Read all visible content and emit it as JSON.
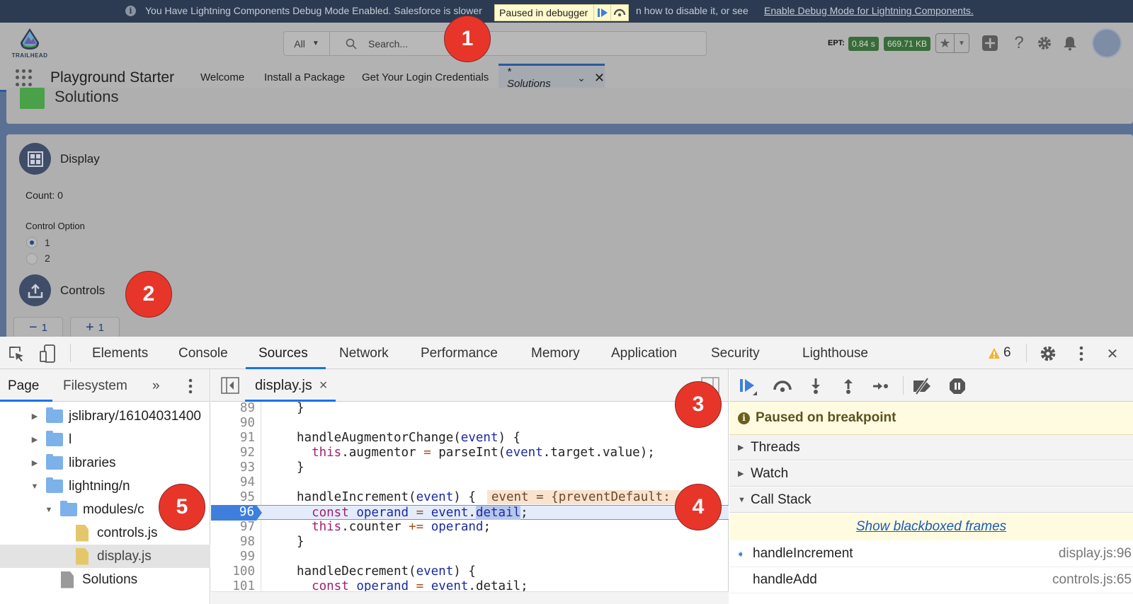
{
  "banner": {
    "message": "You Have Lightning Components Debug Mode Enabled. Salesforce is slower",
    "message_tail": "n how to disable it, or see",
    "link": "Enable Debug Mode for Lightning Components.",
    "paused_label": "Paused in debugger",
    "icons": [
      "resume-icon",
      "step-over-icon"
    ]
  },
  "header": {
    "logo_text": "TRAILHEAD",
    "search_scope": "All",
    "search_placeholder": "Search...",
    "ept_label": "EPT:",
    "ept_time": "0.84 s",
    "ept_size": "669.71 KB",
    "icons": [
      "favorite-star-icon",
      "add-icon",
      "help-icon",
      "setup-gear-icon",
      "notifications-bell-icon",
      "avatar"
    ]
  },
  "nav": {
    "app_name": "Playground Starter",
    "items": [
      "Welcome",
      "Install a Package",
      "Get Your Login Credentials"
    ],
    "active_tab": "* Solutions"
  },
  "page": {
    "title": "Solutions",
    "display": {
      "title": "Display",
      "count_label": "Count: 0",
      "control_option_label": "Control Option",
      "options": [
        {
          "label": "1",
          "checked": true
        },
        {
          "label": "2",
          "checked": false
        }
      ]
    },
    "controls": {
      "title": "Controls",
      "buttons": [
        {
          "sign": "−",
          "value": "1"
        },
        {
          "sign": "+",
          "value": "1"
        }
      ]
    }
  },
  "callouts": [
    "1",
    "2",
    "3",
    "4",
    "5"
  ],
  "devtools": {
    "tabs": [
      "Elements",
      "Console",
      "Sources",
      "Network",
      "Performance",
      "Memory",
      "Application",
      "Security",
      "Lighthouse"
    ],
    "active_tab": "Sources",
    "warning_count": "6",
    "navigator": {
      "tabs": [
        "Page",
        "Filesystem"
      ],
      "active_tab": "Page",
      "more": "»",
      "tree": [
        {
          "label": "jslibrary/16104031400",
          "type": "folder",
          "expanded": false,
          "depth": 1
        },
        {
          "label": "l",
          "type": "folder",
          "expanded": false,
          "depth": 1
        },
        {
          "label": "libraries",
          "type": "folder",
          "expanded": false,
          "depth": 1
        },
        {
          "label": "lightning/n",
          "type": "folder",
          "expanded": true,
          "depth": 1
        },
        {
          "label": "modules/c",
          "type": "folder",
          "expanded": true,
          "depth": 2
        },
        {
          "label": "controls.js",
          "type": "js",
          "depth": 3
        },
        {
          "label": "display.js",
          "type": "js",
          "depth": 3,
          "selected": true
        },
        {
          "label": "Solutions",
          "type": "doc",
          "depth": 2
        }
      ]
    },
    "editor": {
      "file_tab": "display.js",
      "close": "×",
      "current_line": 96,
      "lines": [
        {
          "n": "89",
          "text": "  }"
        },
        {
          "n": "90",
          "text": ""
        },
        {
          "n": "91",
          "text": "  handleAugmentorChange(event) {"
        },
        {
          "n": "92",
          "text": "    this.augmentor = parseInt(event.target.value);"
        },
        {
          "n": "93",
          "text": "  }"
        },
        {
          "n": "94",
          "text": ""
        },
        {
          "n": "95",
          "text": "  handleIncrement(event) {",
          "inline_value": "event = {preventDefault: f, s"
        },
        {
          "n": "96",
          "text": "    const operand = event.detail;"
        },
        {
          "n": "97",
          "text": "    this.counter += operand;"
        },
        {
          "n": "98",
          "text": "  }"
        },
        {
          "n": "99",
          "text": ""
        },
        {
          "n": "100",
          "text": "  handleDecrement(event) {"
        },
        {
          "n": "101",
          "text": "    const operand = event.detail;"
        }
      ]
    },
    "debugger": {
      "toolbar": [
        "resume-icon",
        "step-over-icon",
        "step-into-icon",
        "step-out-icon",
        "step-icon",
        "deactivate-breakpoints-icon",
        "pause-on-exceptions-icon"
      ],
      "paused_message": "Paused on breakpoint",
      "sections": [
        {
          "label": "Threads",
          "expanded": false
        },
        {
          "label": "Watch",
          "expanded": false
        },
        {
          "label": "Call Stack",
          "expanded": true
        }
      ],
      "blackboxed_link": "Show blackboxed frames",
      "call_stack": [
        {
          "fn": "handleIncrement",
          "loc": "display.js:96",
          "current": true
        },
        {
          "fn": "handleAdd",
          "loc": "controls.js:65",
          "current": false
        }
      ]
    }
  }
}
